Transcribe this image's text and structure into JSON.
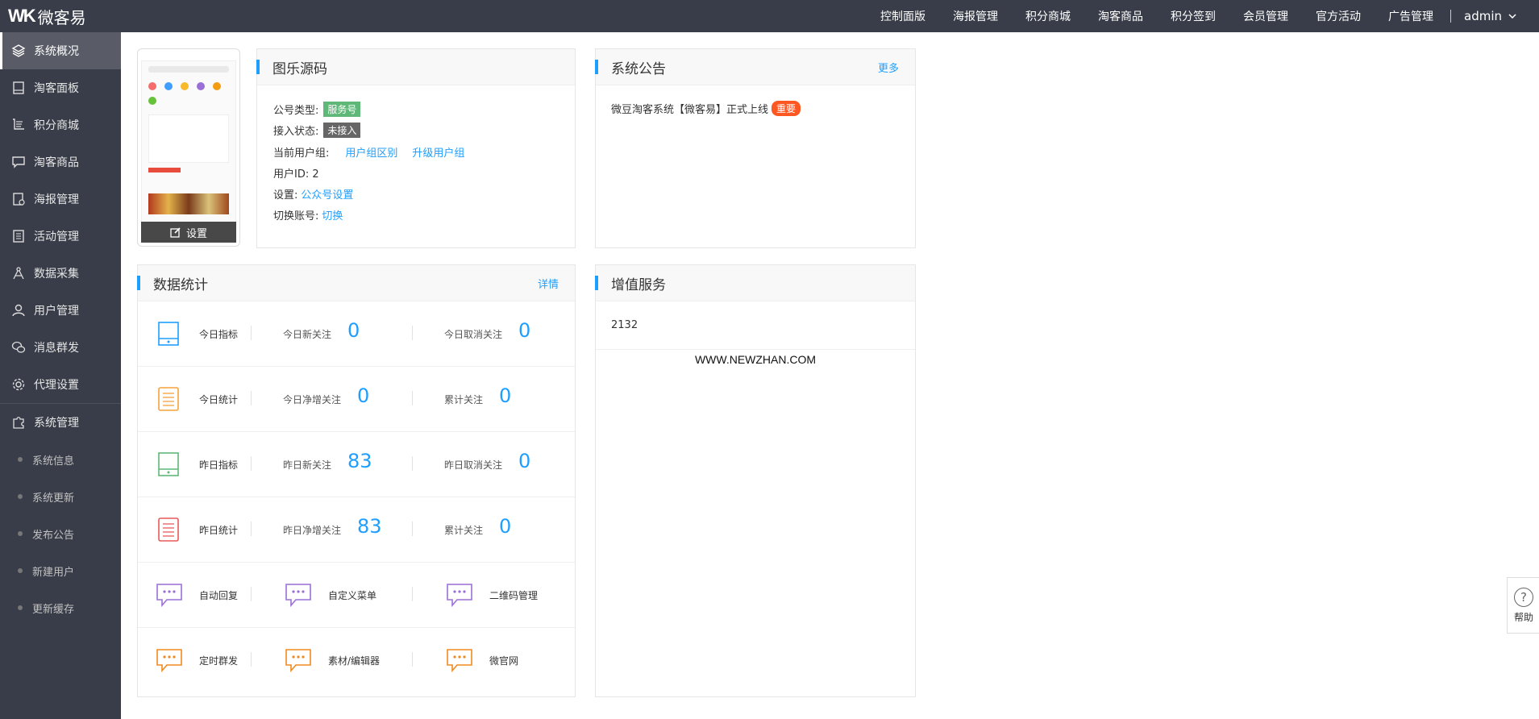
{
  "header": {
    "logo_mark": "WK",
    "logo_text": "微客易",
    "nav": [
      "控制面版",
      "海报管理",
      "积分商城",
      "淘客商品",
      "积分签到",
      "会员管理",
      "官方活动",
      "广告管理"
    ],
    "user": "admin"
  },
  "sidebar": {
    "items": [
      {
        "label": "系统概况",
        "icon": "layers-icon"
      },
      {
        "label": "淘客面板",
        "icon": "tablet-icon"
      },
      {
        "label": "积分商城",
        "icon": "cart-icon"
      },
      {
        "label": "淘客商品",
        "icon": "chat-icon"
      },
      {
        "label": "海报管理",
        "icon": "poster-icon"
      },
      {
        "label": "活动管理",
        "icon": "list-icon"
      },
      {
        "label": "数据采集",
        "icon": "compass-icon"
      },
      {
        "label": "用户管理",
        "icon": "user-icon"
      },
      {
        "label": "消息群发",
        "icon": "wechat-icon"
      },
      {
        "label": "代理设置",
        "icon": "gear-icon"
      },
      {
        "label": "系统管理",
        "icon": "puzzle-icon"
      }
    ],
    "subitems": [
      "系统信息",
      "系统更新",
      "发布公告",
      "新建用户",
      "更新缓存"
    ]
  },
  "phone": {
    "button_label": "设置"
  },
  "account": {
    "title": "图乐源码",
    "type_label": "公号类型:",
    "type_value": "服务号",
    "status_label": "接入状态:",
    "status_value": "未接入",
    "group_label": "当前用户组:",
    "group_link1": "用户组区别",
    "group_link2": "升级用户组",
    "uid_text": "用户ID: 2",
    "settings_label": "设置:",
    "settings_link": "公众号设置",
    "switch_label": "切换账号:",
    "switch_link": "切换"
  },
  "notice": {
    "title": "系统公告",
    "more": "更多",
    "item": "微豆淘客系统【微客易】正式上线",
    "badge": "重要"
  },
  "stats": {
    "title": "数据统计",
    "more": "详情",
    "rows": [
      {
        "name": "今日指标",
        "l1": "今日新关注",
        "v1": "0",
        "l2": "今日取消关注",
        "v2": "0",
        "color": "#1e9fff"
      },
      {
        "name": "今日统计",
        "l1": "今日净增关注",
        "v1": "0",
        "l2": "累计关注",
        "v2": "0",
        "color": "#f7a23b"
      },
      {
        "name": "昨日指标",
        "l1": "昨日新关注",
        "v1": "83",
        "l2": "昨日取消关注",
        "v2": "0",
        "color": "#5fb878"
      },
      {
        "name": "昨日统计",
        "l1": "昨日净增关注",
        "v1": "83",
        "l2": "累计关注",
        "v2": "0",
        "color": "#e85a5a"
      }
    ],
    "links_row1": [
      "自动回复",
      "自定义菜单",
      "二维码管理"
    ],
    "links_row2": [
      "定时群发",
      "素材/编辑器",
      "微官网"
    ],
    "purple": "#9b6fd6",
    "orange": "#f08a1e"
  },
  "vas": {
    "title": "增值服务",
    "value": "2132",
    "watermark": "WWW.NEWZHAN.COM"
  },
  "help": {
    "label": "帮助"
  }
}
